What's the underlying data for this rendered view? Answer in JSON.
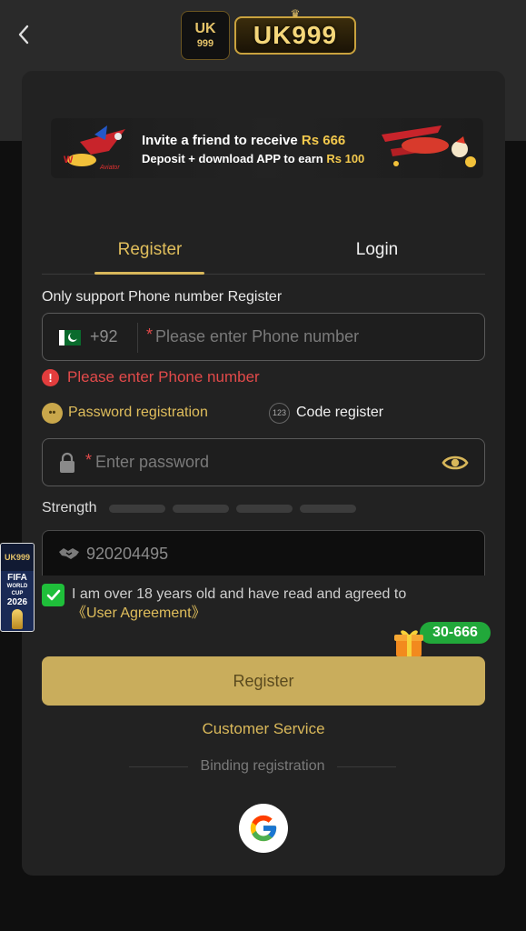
{
  "header": {
    "back_icon": "chevron-left-icon",
    "logo_badge_line1": "UK",
    "logo_badge_line2": "999",
    "logo_wordmark": "UK999"
  },
  "banner": {
    "line1_prefix": "Invite a friend to receive",
    "line1_amount": "Rs 666",
    "line2_prefix": "Deposit + download APP to earn",
    "line2_amount": "Rs 100",
    "aviator_label": "Aviator"
  },
  "tabs": [
    {
      "label": "Register",
      "active": true
    },
    {
      "label": "Login",
      "active": false
    }
  ],
  "form": {
    "support_text": "Only support Phone number Register",
    "country_code": "+92",
    "phone_placeholder": "Please enter Phone number",
    "phone_error": "Please enter Phone number",
    "option_password": "Password registration",
    "option_code": "Code register",
    "option_code_icon_text": "123",
    "password_placeholder": "Enter password",
    "required_mark": "*",
    "strength_label": "Strength",
    "strength_segments": 4,
    "invite_code": "920204495",
    "agree_text": "I am over 18 years old and have read and agreed to",
    "agreement_link": "《User Agreement》",
    "register_button": "Register",
    "customer_service": "Customer Service",
    "binding_label": "Binding registration"
  },
  "promo": {
    "gift_label": "30-666"
  },
  "side_float": {
    "top_label": "UK999",
    "mid_label_1": "FIFA",
    "mid_label_2": "WORLD CUP",
    "mid_label_3": "2026"
  },
  "colors": {
    "accent_gold": "#d8b75a",
    "error_red": "#e24a4a",
    "check_green": "#1fbf3a",
    "card_bg": "#222222"
  }
}
